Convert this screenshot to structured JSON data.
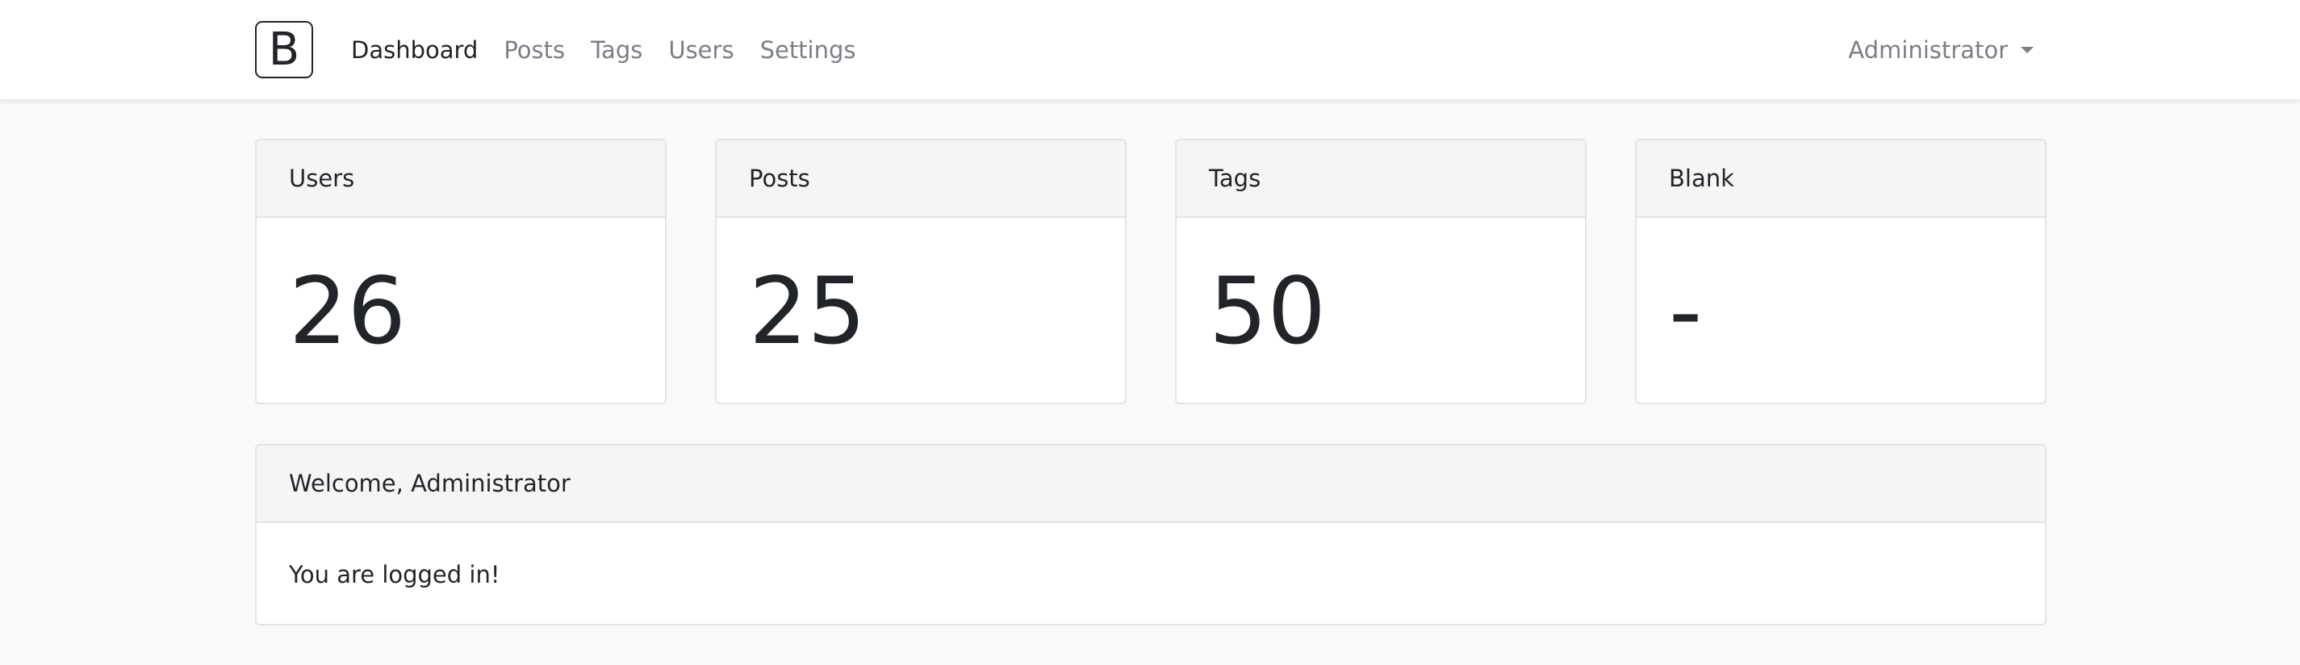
{
  "navbar": {
    "brand": "B",
    "links": [
      "Dashboard",
      "Posts",
      "Tags",
      "Users",
      "Settings"
    ],
    "user": "Administrator"
  },
  "stats": [
    {
      "title": "Users",
      "value": "26"
    },
    {
      "title": "Posts",
      "value": "25"
    },
    {
      "title": "Tags",
      "value": "50"
    },
    {
      "title": "Blank",
      "value": "-"
    }
  ],
  "welcome": {
    "title": "Welcome, Administrator",
    "message": "You are logged in!"
  }
}
